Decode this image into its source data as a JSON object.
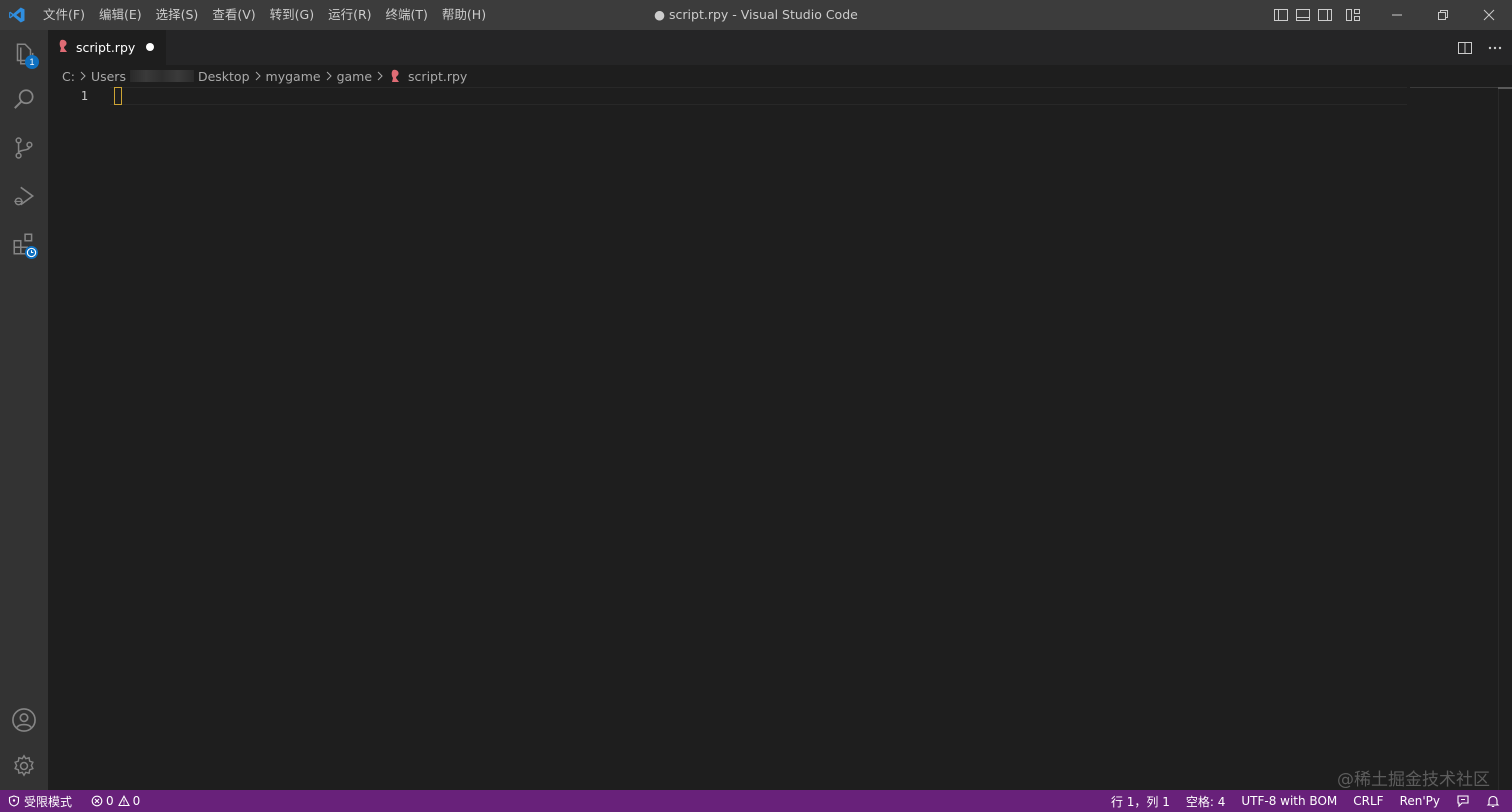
{
  "titlebar": {
    "menu": [
      "文件(F)",
      "编辑(E)",
      "选择(S)",
      "查看(V)",
      "转到(G)",
      "运行(R)",
      "终端(T)",
      "帮助(H)"
    ],
    "window_title": "● script.rpy - Visual Studio Code"
  },
  "activitybar": {
    "explorer_badge": "1"
  },
  "tabs": [
    {
      "label": "script.rpy",
      "dirty": true
    }
  ],
  "breadcrumbs": [
    "C:",
    "Users",
    "Desktop",
    "mygame",
    "game",
    "script.rpy"
  ],
  "editor": {
    "line_numbers": [
      "1"
    ]
  },
  "statusbar": {
    "restricted_mode": "受限模式",
    "errors": "0",
    "warnings": "0",
    "position": "行 1，列 1",
    "indent": "空格: 4",
    "encoding": "UTF-8 with BOM",
    "eol": "CRLF",
    "language": "Ren'Py"
  },
  "watermark": "@稀土掘金技术社区",
  "colors": {
    "statusbar": "#68217a",
    "accent": "#0e70c0",
    "renpy_icon": "#e06c75"
  }
}
